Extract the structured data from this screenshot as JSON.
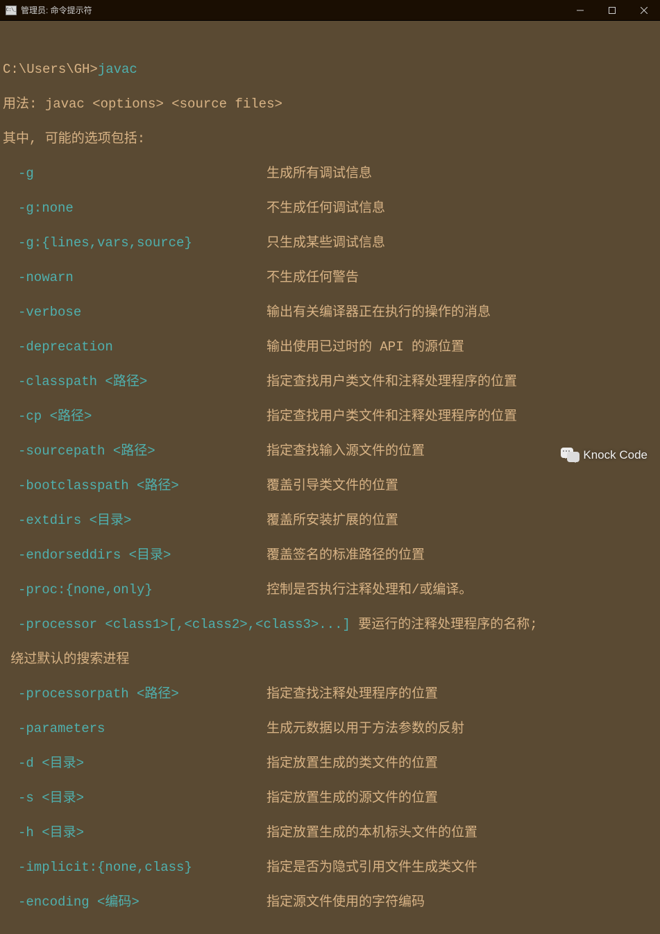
{
  "titlebar": {
    "title": "管理员: 命令提示符"
  },
  "terminal": {
    "blank": "",
    "prompt": "C:\\Users\\GH>",
    "command": "javac",
    "usage_label": "用法: ",
    "usage_syntax": "javac <options> <source files>",
    "options_header": "其中, 可能的选项包括:",
    "options": [
      {
        "flag": "-g",
        "desc": "生成所有调试信息"
      },
      {
        "flag": "-g:none",
        "desc": "不生成任何调试信息"
      },
      {
        "flag": "-g:{lines,vars,source}",
        "desc": "只生成某些调试信息"
      },
      {
        "flag": "-nowarn",
        "desc": "不生成任何警告"
      },
      {
        "flag": "-verbose",
        "desc": "输出有关编译器正在执行的操作的消息"
      },
      {
        "flag": "-deprecation",
        "desc": "输出使用已过时的 API 的源位置"
      },
      {
        "flag": "-classpath <路径>",
        "desc": "指定查找用户类文件和注释处理程序的位置"
      },
      {
        "flag": "-cp <路径>",
        "desc": "指定查找用户类文件和注释处理程序的位置"
      },
      {
        "flag": "-sourcepath <路径>",
        "desc": "指定查找输入源文件的位置"
      },
      {
        "flag": "-bootclasspath <路径>",
        "desc": "覆盖引导类文件的位置"
      },
      {
        "flag": "-extdirs <目录>",
        "desc": "覆盖所安装扩展的位置"
      },
      {
        "flag": "-endorseddirs <目录>",
        "desc": "覆盖签名的标准路径的位置"
      },
      {
        "flag": "-proc:{none,only}",
        "desc": "控制是否执行注释处理和/或编译。"
      }
    ],
    "processor_flag": "-processor <class1>[,<class2>,<class3>...]",
    "processor_desc": " 要运行的注释处理程序的名称;",
    "processor_wrap": " 绕过默认的搜索进程",
    "options2": [
      {
        "flag": "-processorpath <路径>",
        "desc": "指定查找注释处理程序的位置"
      },
      {
        "flag": "-parameters",
        "desc": "生成元数据以用于方法参数的反射"
      },
      {
        "flag": "-d <目录>",
        "desc": "指定放置生成的类文件的位置"
      },
      {
        "flag": "-s <目录>",
        "desc": "指定放置生成的源文件的位置"
      },
      {
        "flag": "-h <目录>",
        "desc": "指定放置生成的本机标头文件的位置"
      },
      {
        "flag": "-implicit:{none,class}",
        "desc": "指定是否为隐式引用文件生成类文件"
      },
      {
        "flag": "-encoding <编码>",
        "desc": "指定源文件使用的字符编码"
      }
    ]
  },
  "watermark": {
    "text": "Knock Code"
  }
}
